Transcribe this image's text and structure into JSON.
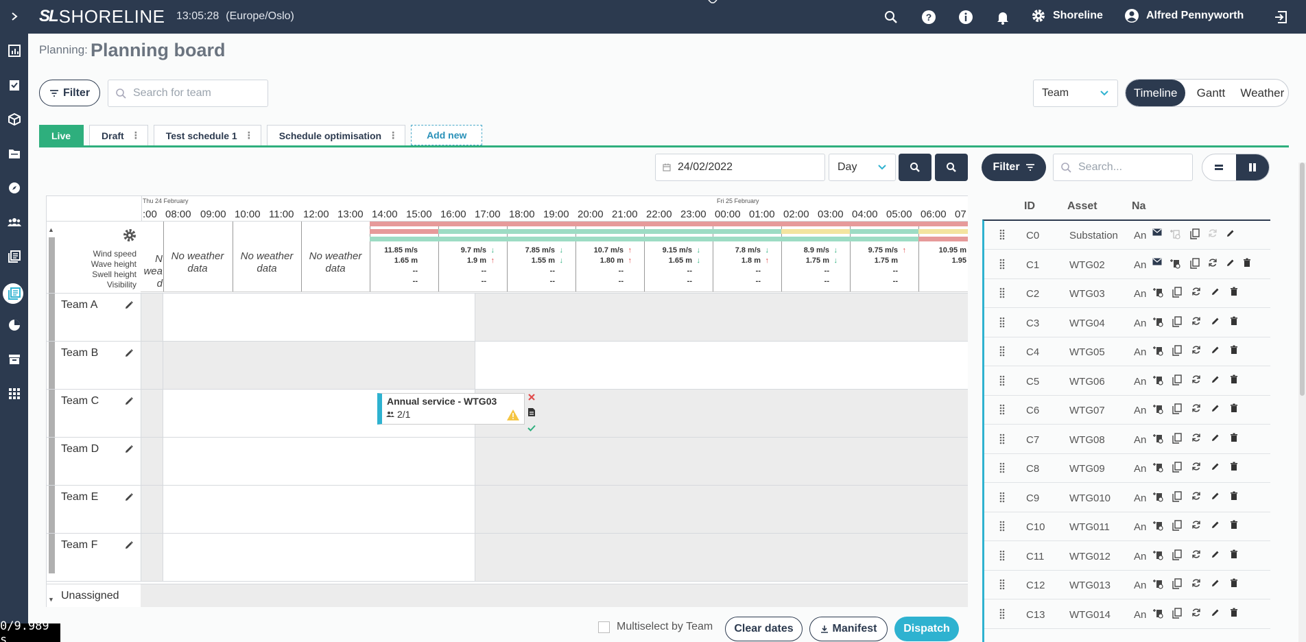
{
  "app": {
    "brand_mark": "SL",
    "brand_name": "SHORELINE",
    "time": "13:05:28",
    "timezone": "(Europe/Oslo)"
  },
  "topbar": {
    "org": "Shoreline",
    "user": "Alfred Pennyworth"
  },
  "page": {
    "crumb": "Planning:",
    "title": "Planning board"
  },
  "toolbar": {
    "filter_label": "Filter",
    "search_placeholder": "Search for team",
    "group_by": "Team",
    "views": [
      {
        "label": "Timeline",
        "active": true
      },
      {
        "label": "Gantt",
        "active": false
      },
      {
        "label": "Weather",
        "active": false
      }
    ]
  },
  "tabs": [
    {
      "label": "Live",
      "kind": "live"
    },
    {
      "label": "Draft",
      "kind": "normal"
    },
    {
      "label": "Test schedule 1",
      "kind": "normal"
    },
    {
      "label": "Schedule optimisation",
      "kind": "normal"
    },
    {
      "label": "Add new",
      "kind": "add"
    }
  ],
  "board": {
    "date": "24/02/2022",
    "range": "Day",
    "day_labels": [
      "Thu 24 February",
      "Fri 25 February"
    ],
    "hours": [
      ":00",
      "08:00",
      "09:00",
      "10:00",
      "11:00",
      "12:00",
      "13:00",
      "14:00",
      "15:00",
      "16:00",
      "17:00",
      "18:00",
      "19:00",
      "20:00",
      "21:00",
      "22:00",
      "23:00",
      "00:00",
      "01:00",
      "02:00",
      "03:00",
      "04:00",
      "05:00",
      "06:00",
      "07"
    ],
    "weather_labels": [
      "Wind speed",
      "Wave height",
      "Swell height",
      "Visibility"
    ],
    "no_weather_partial": [
      "N",
      "wea",
      "d"
    ],
    "no_weather": "No weather data",
    "weather": [
      {
        "wind": "11.85 m/s",
        "wind_dir": "",
        "wave": "1.65 m",
        "wave_dir": "",
        "swell": "--",
        "vis": "--"
      },
      {
        "wind": "9.7 m/s",
        "wind_dir": "↓",
        "wave": "1.9 m",
        "wave_dir": "↑",
        "swell": "--",
        "vis": "--"
      },
      {
        "wind": "7.85 m/s",
        "wind_dir": "↓",
        "wave": "1.55 m",
        "wave_dir": "↓",
        "swell": "--",
        "vis": "--"
      },
      {
        "wind": "10.7 m/s",
        "wind_dir": "↑",
        "wave": "1.80 m",
        "wave_dir": "↑",
        "swell": "--",
        "vis": "--"
      },
      {
        "wind": "9.15 m/s",
        "wind_dir": "↓",
        "wave": "1.65 m",
        "wave_dir": "↓",
        "swell": "--",
        "vis": "--"
      },
      {
        "wind": "7.8 m/s",
        "wind_dir": "↓",
        "wave": "1.8 m",
        "wave_dir": "↑",
        "swell": "--",
        "vis": "--"
      },
      {
        "wind": "8.9 m/s",
        "wind_dir": "↓",
        "wave": "1.75 m",
        "wave_dir": "↓",
        "swell": "--",
        "vis": "--"
      },
      {
        "wind": "9.75 m/s",
        "wind_dir": "↑",
        "wave": "1.75 m",
        "wave_dir": "",
        "swell": "--",
        "vis": "--"
      },
      {
        "wind": "10.95 m",
        "wind_dir": "",
        "wave": "1.95",
        "wave_dir": "",
        "swell": "",
        "vis": ""
      }
    ],
    "teams": [
      "Team A",
      "Team B",
      "Team C",
      "Team D",
      "Team E",
      "Team F"
    ],
    "unassigned": "Unassigned",
    "task": {
      "title": "Annual service - WTG03",
      "crew": "2/1"
    }
  },
  "bottom": {
    "multiselect": "Multiselect by Team",
    "clear": "Clear dates",
    "manifest": "Manifest",
    "dispatch": "Dispatch"
  },
  "right": {
    "filter": "Filter",
    "search_placeholder": "Search...",
    "headers": {
      "id": "ID",
      "asset": "Asset",
      "name": "Na"
    },
    "rows": [
      {
        "id": "C0",
        "asset": "Substation",
        "name": "An"
      },
      {
        "id": "C1",
        "asset": "WTG02",
        "name": "An"
      },
      {
        "id": "C2",
        "asset": "WTG03",
        "name": "An"
      },
      {
        "id": "C3",
        "asset": "WTG04",
        "name": "An"
      },
      {
        "id": "C4",
        "asset": "WTG05",
        "name": "An"
      },
      {
        "id": "C5",
        "asset": "WTG06",
        "name": "An"
      },
      {
        "id": "C6",
        "asset": "WTG07",
        "name": "An"
      },
      {
        "id": "C7",
        "asset": "WTG08",
        "name": "An"
      },
      {
        "id": "C8",
        "asset": "WTG09",
        "name": "An"
      },
      {
        "id": "C9",
        "asset": "WTG010",
        "name": "An"
      },
      {
        "id": "C10",
        "asset": "WTG011",
        "name": "An"
      },
      {
        "id": "C11",
        "asset": "WTG012",
        "name": "An"
      },
      {
        "id": "C12",
        "asset": "WTG013",
        "name": "An"
      },
      {
        "id": "C13",
        "asset": "WTG014",
        "name": "An"
      }
    ]
  },
  "overlay": {
    "timer": "0/9.989 s"
  },
  "colors": {
    "navy": "#2c3a4f",
    "green": "#2eaf7d",
    "cyan": "#2eb2d0",
    "red_bar": "#e69a9a",
    "green_bar": "#9ddcc4",
    "yellow_bar": "#f3e4a0"
  }
}
